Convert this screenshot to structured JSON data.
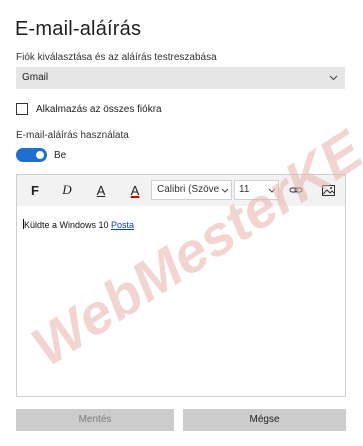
{
  "header": {
    "title": "E-mail-aláírás"
  },
  "account": {
    "label": "Fiók kiválasztása és az aláírás testreszabása",
    "selected": "Gmail"
  },
  "apply_all": {
    "label": "Alkalmazás az összes fiókra",
    "checked": false
  },
  "usage": {
    "label": "E-mail-aláírás használata",
    "toggle_state": "Be",
    "toggle_on": true,
    "accent_color": "#1e6fd0"
  },
  "toolbar": {
    "bold": "F",
    "italic": "D",
    "underline": "A",
    "font_color": "A",
    "font_color_value": "#d40000",
    "font_family": "Calibri (Szöve",
    "font_size": "11"
  },
  "editor": {
    "text": "Küldte a Windows 10 ",
    "link_text": "Posta"
  },
  "footer": {
    "save_label": "Mentés",
    "cancel_label": "Mégse"
  },
  "watermark": {
    "text": "WebMesterKE",
    "color": "#e8b4ad"
  }
}
